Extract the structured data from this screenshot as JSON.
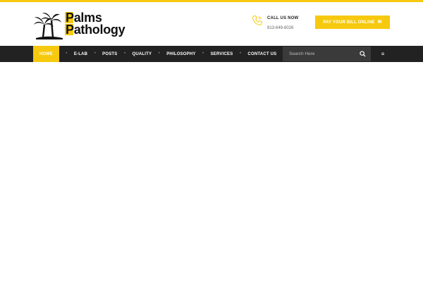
{
  "brand": {
    "line1": "Palms",
    "line2": "Pathology",
    "accent_color": "#f6c90e",
    "logo_icon": "palm-trees-icon"
  },
  "contact": {
    "title": "CALL US NOW",
    "phone": "813-649-8026",
    "icon": "phone-icon"
  },
  "pay_button": {
    "label": "PAY YOUR BILL ONLINE",
    "icon": "mail-icon"
  },
  "nav": {
    "items": [
      {
        "label": "HOME",
        "active": true
      },
      {
        "label": "E-LAB",
        "active": false
      },
      {
        "label": "POSTS",
        "active": false
      },
      {
        "label": "QUALITY",
        "active": false
      },
      {
        "label": "PHILOSOPHY",
        "active": false
      },
      {
        "label": "SERVICES",
        "active": false
      },
      {
        "label": "CONTACT US",
        "active": false
      }
    ],
    "separator": "•",
    "background": "#222222"
  },
  "search": {
    "placeholder": "Search Here",
    "icon": "search-icon"
  },
  "menu_button": {
    "icon": "hamburger-menu-icon",
    "glyph": "≡"
  }
}
